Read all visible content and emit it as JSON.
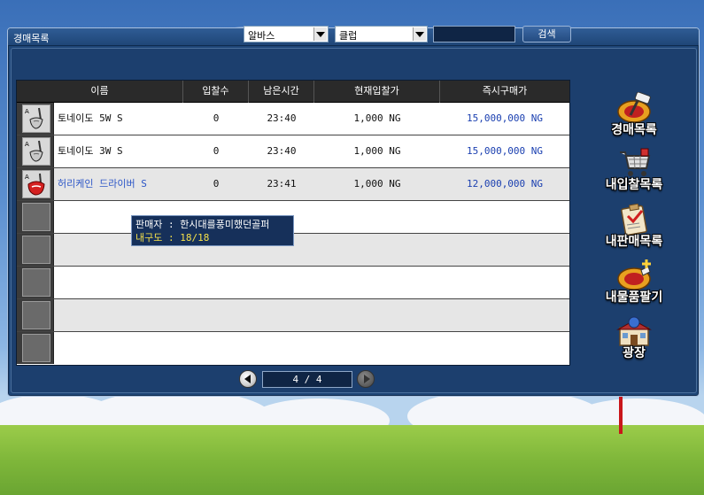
{
  "window": {
    "title": "경매목록"
  },
  "filters": {
    "category_value": "알바스",
    "type_value": "클럽",
    "search_value": "",
    "search_label": "검색"
  },
  "table": {
    "columns": [
      "이름",
      "입찰수",
      "남은시간",
      "현재입찰가",
      "즉시구매가"
    ],
    "rows": [
      {
        "name": "토네이도 5W S",
        "bids": "0",
        "time": "23:40",
        "current": "1,000 NG",
        "buyout": "15,000,000 NG",
        "icon": "fairway-wood-icon"
      },
      {
        "name": "토네이도 3W S",
        "bids": "0",
        "time": "23:40",
        "current": "1,000 NG",
        "buyout": "15,000,000 NG",
        "icon": "fairway-wood-icon"
      },
      {
        "name": "허리케인 드라이버 S",
        "bids": "0",
        "time": "23:41",
        "current": "1,000 NG",
        "buyout": "12,000,000 NG",
        "icon": "driver-icon"
      }
    ],
    "empty_rows": 5
  },
  "tooltip": {
    "seller": "판매자 : 한시대를풍미했던골퍼",
    "durability": "내구도 : 18/18"
  },
  "pager": {
    "text": "4 / 4"
  },
  "side_menu": [
    {
      "label": "경매목록",
      "icon": "auction-hammer-icon"
    },
    {
      "label": "내입찰목록",
      "icon": "shopping-cart-icon"
    },
    {
      "label": "내판매목록",
      "icon": "clipboard-icon"
    },
    {
      "label": "내물품팔기",
      "icon": "sell-item-icon"
    },
    {
      "label": "광장",
      "icon": "plaza-building-icon"
    }
  ],
  "colors": {
    "panel": "#1f4677",
    "price_blue": "#1a3fb0",
    "tooltip_yellow": "#f5e14a"
  }
}
